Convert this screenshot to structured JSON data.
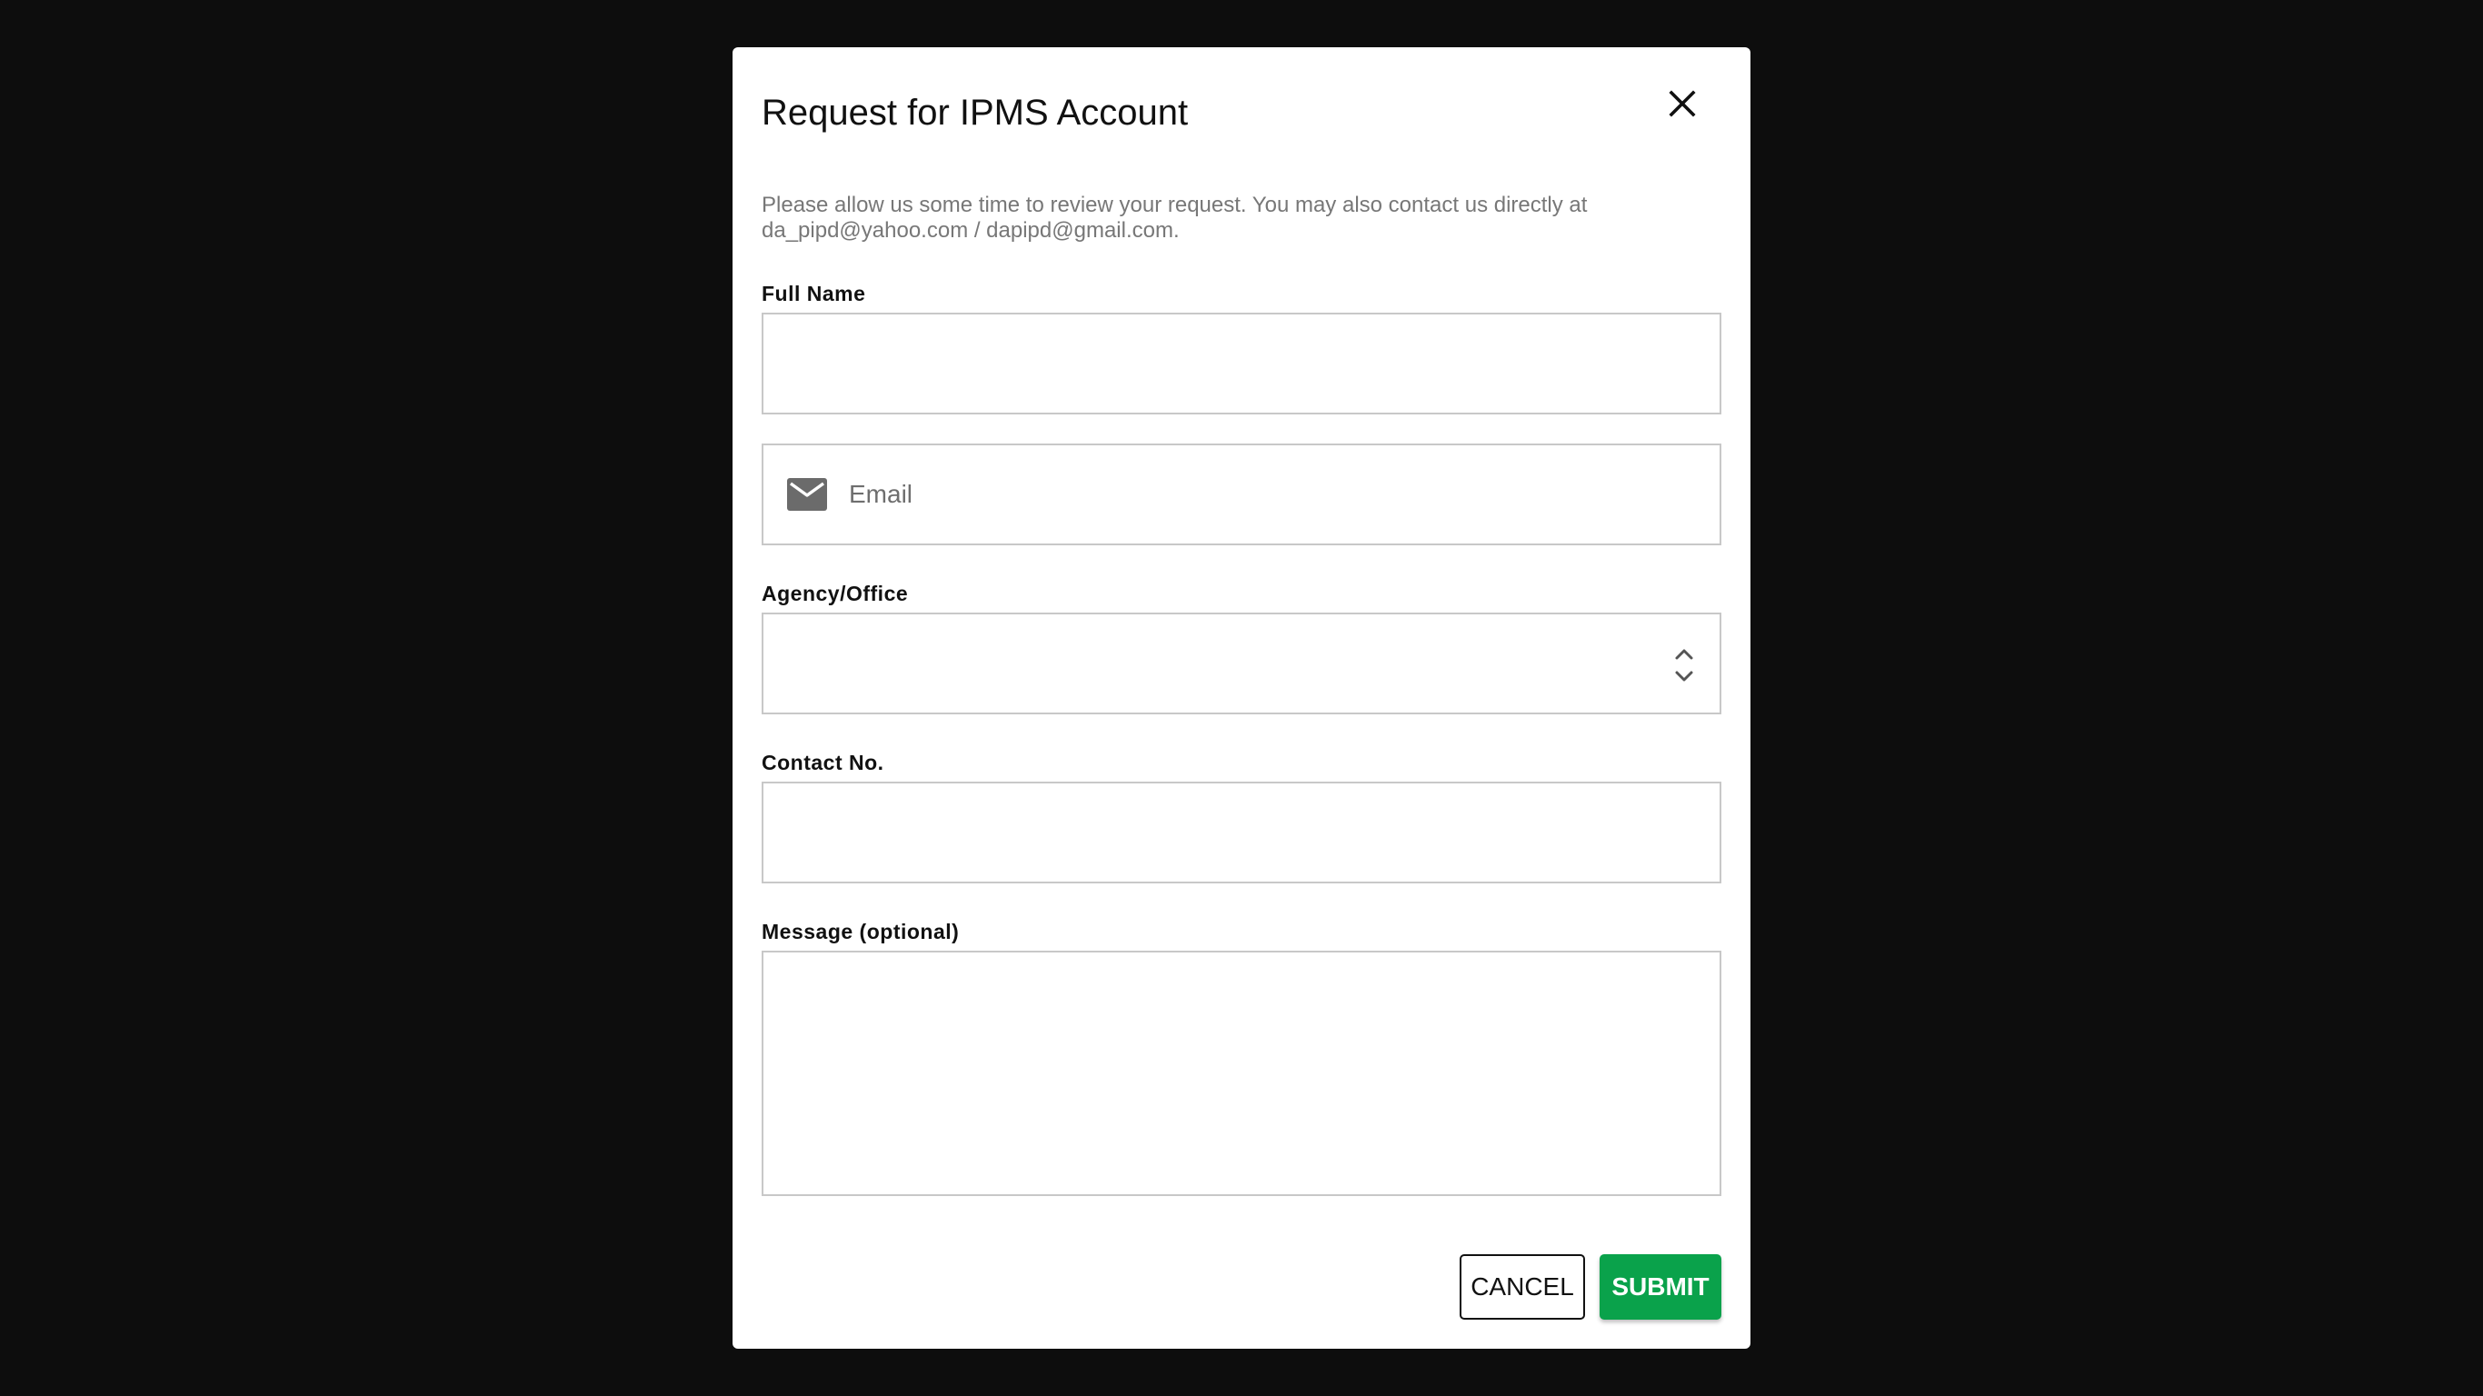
{
  "dialog": {
    "title": "Request for IPMS Account",
    "intro_line1": "Please allow us some time to review your request. You may also contact us directly at",
    "intro_line2": "da_pipd@yahoo.com / dapipd@gmail.com."
  },
  "form": {
    "full_name": {
      "label": "Full Name",
      "value": ""
    },
    "email": {
      "placeholder": "Email",
      "value": "",
      "icon": "mail-icon"
    },
    "agency": {
      "label": "Agency/Office",
      "selected": "",
      "icon": "unfold-icon"
    },
    "contact": {
      "label": "Contact No.",
      "value": ""
    },
    "message": {
      "label": "Message (optional)",
      "value": ""
    }
  },
  "actions": {
    "cancel_label": "CANCEL",
    "submit_label": "SUBMIT"
  },
  "colors": {
    "backdrop": "#0d0d0d",
    "submit_bg": "#0aa24b",
    "border": "#c8c8c8",
    "muted_text": "#777777"
  }
}
